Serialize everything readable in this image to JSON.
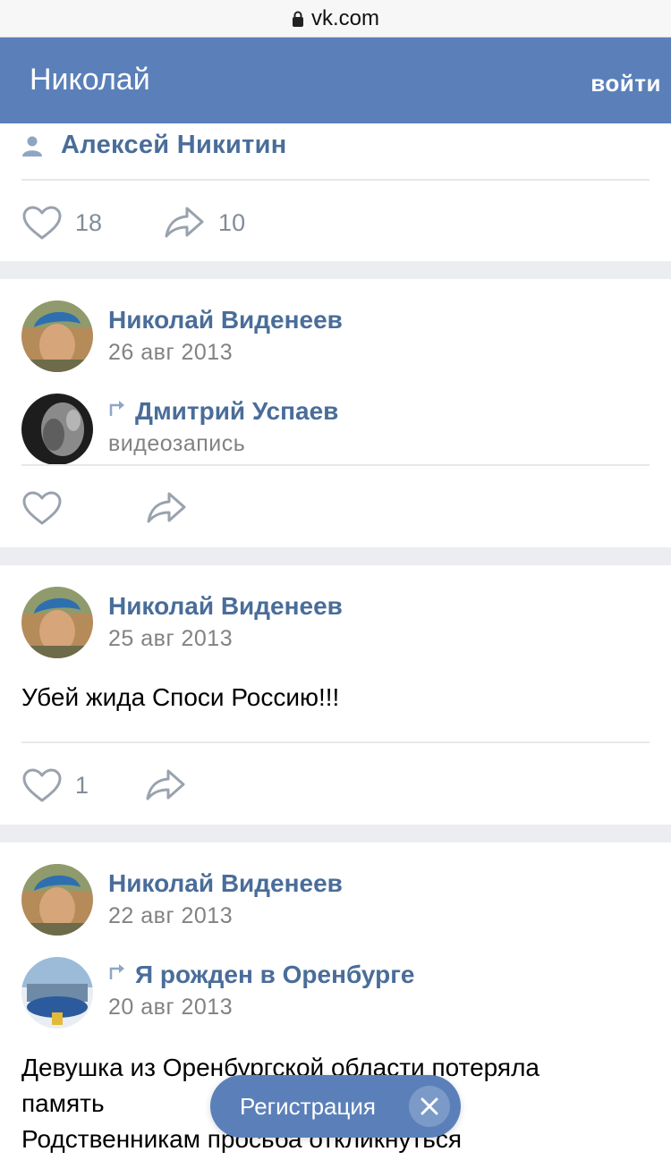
{
  "browser": {
    "url": "vk.com"
  },
  "header": {
    "title": "Николай",
    "login": "войти"
  },
  "top_post": {
    "author": "Алексей Никитин",
    "likes": "18",
    "shares": "10"
  },
  "posts": [
    {
      "author": "Николай Виденеев",
      "date": "26 авг 2013",
      "repost": {
        "author": "Дмитрий Успаев",
        "sub": "видеозапись"
      }
    },
    {
      "author": "Николай Виденеев",
      "date": "25 авг 2013",
      "text": "Убей жида Споси Россию!!!",
      "likes": "1"
    },
    {
      "author": "Николай Виденеев",
      "date": "22 авг 2013",
      "repost": {
        "author": "Я рожден в Оренбурге",
        "sub": "20 авг 2013"
      },
      "text_lines": [
        "Девушка из Оренбургской области потеряла",
        "память",
        "Родственникам просьба откликнуться"
      ]
    }
  ],
  "registration": {
    "label": "Регистрация"
  },
  "colors": {
    "header": "#5b80b9",
    "link": "#4a6d99",
    "muted": "#828282",
    "icon": "#818c99",
    "separator": "#ebedf0"
  }
}
